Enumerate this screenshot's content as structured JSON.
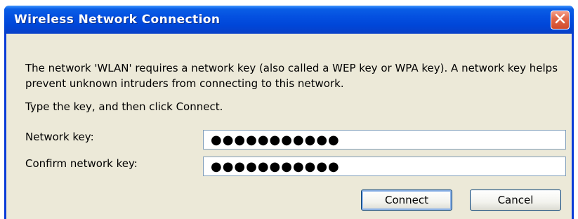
{
  "window": {
    "title": "Wireless Network Connection",
    "close_icon": "close-icon"
  },
  "message": "The network 'WLAN' requires a network key (also called a WEP key or WPA key). A network key helps prevent unknown intruders from connecting to this network.",
  "instruction": "Type the key, and then click Connect.",
  "fields": {
    "network_key_label": "Network key:",
    "network_key_value": "●●●●●●●●●●●",
    "confirm_key_label": "Confirm network key:",
    "confirm_key_value": "●●●●●●●●●●●"
  },
  "buttons": {
    "connect": "Connect",
    "cancel": "Cancel"
  },
  "colors": {
    "title_bar": "#0450e0",
    "dialog_bg": "#ece9d8",
    "close_button": "#e36a4a"
  }
}
